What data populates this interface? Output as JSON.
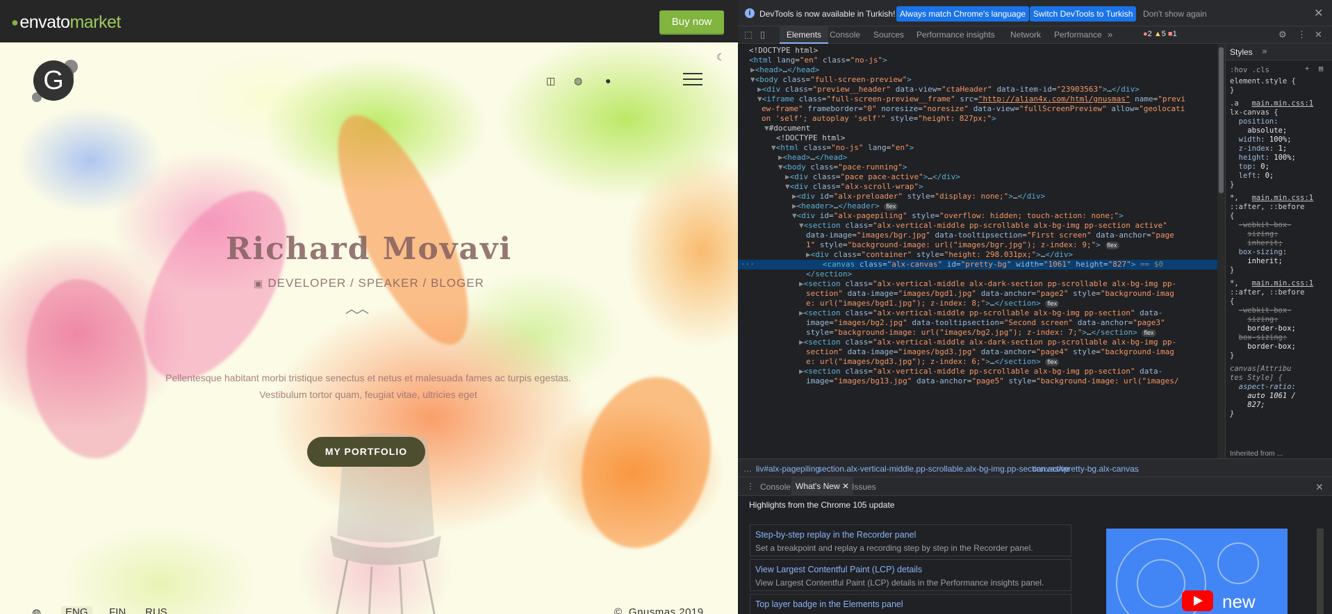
{
  "envato": {
    "logo_text": "envato",
    "logo_market": "market",
    "buy_label": "Buy now"
  },
  "site": {
    "logo_letter": "G",
    "hero_title": "Richard Movavi",
    "hero_sub": "DEVELOPER / SPEAKER / BLOGER",
    "hero_text": "Pellentesque habitant morbi tristique senectus et netus et malesuada fames ac turpis egestas. Vestibulum tortor quam, feugiat vitae, ultricies eget",
    "portfolio_label": "MY PORTFOLIO",
    "languages": [
      "ENG",
      "FIN",
      "RUS"
    ],
    "copyright": "Gnusmas 2019"
  },
  "devtools": {
    "info_text": "DevTools is now available in Turkish!",
    "info_btn_1": "Always match Chrome's language",
    "info_btn_2": "Switch DevTools to Turkish",
    "info_dismiss": "Don't show again",
    "tabs": [
      "Elements",
      "Console",
      "Sources",
      "Performance insights",
      "Network",
      "Performance"
    ],
    "errors": "2",
    "warnings": "5",
    "issues": "1",
    "styles_tab": "Styles",
    "styles_filter": ":hov .cls",
    "breadcrumbs": [
      "liv#alx-pagepiling",
      "section.alx-vertical-middle.pp-scrollable.alx-bg-img.pp-section.active",
      "canvas#pretty-bg.alx-canvas"
    ],
    "drawer_tabs": [
      "Console",
      "What's New",
      "Issues"
    ],
    "highlights": "Highlights from the Chrome 105 update",
    "whats_new": [
      {
        "title": "Step-by-step replay in the Recorder panel",
        "desc": "Set a breakpoint and replay a recording step by step in the Recorder panel."
      },
      {
        "title": "View Largest Contentful Paint (LCP) details",
        "desc": "View Largest Contentful Paint (LCP) details in the Performance insights panel."
      },
      {
        "title": "Top layer badge in the Elements panel",
        "desc": ""
      }
    ],
    "video_new": "new",
    "inherited": "Inherited from ..."
  },
  "colors": {
    "envato_green": "#82b440",
    "devtools_bg": "#202124",
    "selection": "#093f72",
    "link": "#8ab4f8"
  }
}
